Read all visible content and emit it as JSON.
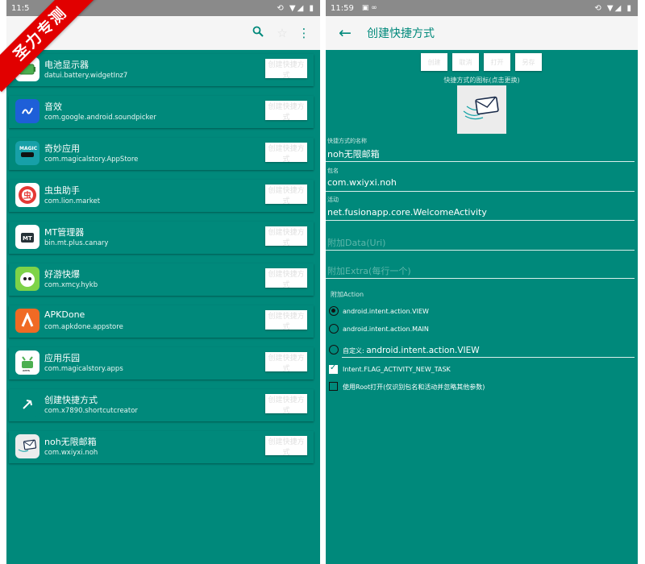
{
  "watermark": "圣力专测",
  "left_screen": {
    "status_time": "11:5",
    "status_icons": "⟲ ▼◢ ▮",
    "toolbar_icons": [
      "search-icon",
      "star-icon",
      "more-vert-icon"
    ],
    "create_label": "创建快捷方式",
    "apps": [
      {
        "name": "电池显示器",
        "package": "datui.battery.widgetInz7",
        "icon": "battery-icon"
      },
      {
        "name": "音效",
        "package": "com.google.android.soundpicker",
        "icon": "sound-icon"
      },
      {
        "name": "奇妙应用",
        "package": "com.magicalstory.AppStore",
        "icon": "magic-app-icon"
      },
      {
        "name": "虫虫助手",
        "package": "com.lion.market",
        "icon": "chongchong-icon"
      },
      {
        "name": "MT管理器",
        "package": "bin.mt.plus.canary",
        "icon": "mt-icon"
      },
      {
        "name": "好游快爆",
        "package": "com.xmcy.hykb",
        "icon": "haoyou-icon"
      },
      {
        "name": "APKDone",
        "package": "com.apkdone.appstore",
        "icon": "apkdone-icon"
      },
      {
        "name": "应用乐园",
        "package": "com.magicalstory.apps",
        "icon": "app-paradise-icon"
      },
      {
        "name": "创建快捷方式",
        "package": "com.x7890.shortcutcreator",
        "icon": "shortcut-creator-icon"
      },
      {
        "name": "noh无限邮箱",
        "package": "com.wxiyxi.noh",
        "icon": "mail-icon"
      }
    ]
  },
  "right_screen": {
    "status_time": "11:59",
    "status_icons": "⟲ ▼◢ ▮",
    "title": "创建快捷方式",
    "top_buttons": [
      "创建",
      "取消",
      "打开",
      "另存"
    ],
    "icon_hint": "快捷方式的图标(点击更换)",
    "fields": [
      {
        "label": "快捷方式的名称",
        "value": "noh无限邮箱"
      },
      {
        "label": "包名",
        "value": "com.wxiyxi.noh"
      },
      {
        "label": "活动",
        "value": "net.fusionapp.core.WelcomeActivity"
      }
    ],
    "data_placeholder": "附加Data(Uri)",
    "extra_placeholder": "附加Extra(每行一个)",
    "action_label": "附加Action",
    "actions": [
      {
        "label": "android.intent.action.VIEW",
        "checked": true
      },
      {
        "label": "android.intent.action.MAIN",
        "checked": false
      }
    ],
    "custom_prefix": "自定义:",
    "custom_value": "android.intent.action.VIEW",
    "checkboxes": [
      {
        "label": "Intent.FLAG_ACTIVITY_NEW_TASK",
        "checked": true
      },
      {
        "label": "使用Root打开(仅识别包名和活动并忽略其他参数)",
        "checked": false
      }
    ]
  }
}
